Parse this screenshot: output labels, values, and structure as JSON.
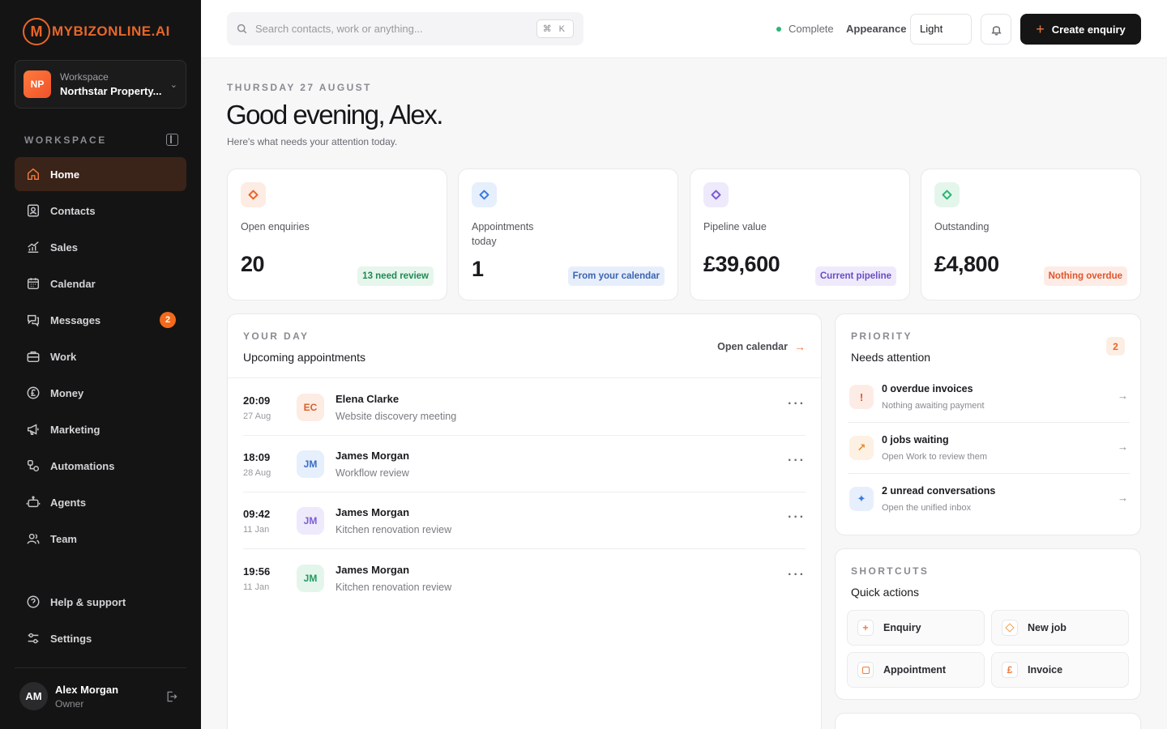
{
  "brand": {
    "logo_mark": "M",
    "logo_text": "MYBIZONLINE.AI",
    "accent": "#e8662a"
  },
  "workspace_switcher": {
    "initials": "NP",
    "label": "Workspace",
    "name": "Northstar Property...",
    "icon": "chevron-down-icon"
  },
  "sidebar": {
    "section_label": "WORKSPACE",
    "items": [
      {
        "label": "Home",
        "icon": "home-icon",
        "active": true
      },
      {
        "label": "Contacts",
        "icon": "contacts-icon"
      },
      {
        "label": "Sales",
        "icon": "sales-chart-icon"
      },
      {
        "label": "Calendar",
        "icon": "calendar-icon"
      },
      {
        "label": "Messages",
        "icon": "messages-icon",
        "badge": "2"
      },
      {
        "label": "Work",
        "icon": "briefcase-icon"
      },
      {
        "label": "Money",
        "icon": "pound-coin-icon"
      },
      {
        "label": "Marketing",
        "icon": "megaphone-icon"
      },
      {
        "label": "Automations",
        "icon": "automation-icon"
      },
      {
        "label": "Agents",
        "icon": "robot-icon"
      },
      {
        "label": "Team",
        "icon": "team-icon"
      }
    ],
    "footer_items": [
      {
        "label": "Help & support",
        "icon": "help-icon"
      },
      {
        "label": "Settings",
        "icon": "settings-icon"
      }
    ],
    "user": {
      "initials": "AM",
      "name": "Alex Morgan",
      "role": "Owner"
    }
  },
  "topbar": {
    "search_placeholder": "Search contacts, work or anything...",
    "shortcut": "⌘ K",
    "status": "Complete",
    "appearance_label": "Appearance",
    "appearance_value": "Light",
    "create_label": "Create enquiry"
  },
  "header": {
    "date": "THURSDAY 27 AUGUST",
    "greeting": "Good evening, Alex.",
    "subtitle": "Here's what needs your attention today."
  },
  "stats": [
    {
      "label": "Open enquiries",
      "value": "20",
      "pill": "13 need review",
      "color": "#e8662a"
    },
    {
      "label": "Appointments today",
      "value": "1",
      "pill": "From your calendar",
      "color": "#3b7be0"
    },
    {
      "label": "Pipeline value",
      "value": "£39,600",
      "pill": "Current pipeline",
      "color": "#7b5cd6"
    },
    {
      "label": "Outstanding",
      "value": "£4,800",
      "pill": "Nothing overdue",
      "color": "#2bb673"
    }
  ],
  "day": {
    "kicker": "YOUR DAY",
    "title": "Upcoming appointments",
    "open_calendar": "Open calendar",
    "appointments": [
      {
        "time": "20:09",
        "date": "27 Aug",
        "initials": "EC",
        "name": "Elena Clarke",
        "subject": "Website discovery meeting"
      },
      {
        "time": "18:09",
        "date": "28 Aug",
        "initials": "JM",
        "name": "James Morgan",
        "subject": "Workflow review"
      },
      {
        "time": "09:42",
        "date": "11 Jan",
        "initials": "JM",
        "name": "James Morgan",
        "subject": "Kitchen renovation review"
      },
      {
        "time": "19:56",
        "date": "11 Jan",
        "initials": "JM",
        "name": "James Morgan",
        "subject": "Kitchen renovation review"
      }
    ]
  },
  "priority": {
    "kicker": "PRIORITY",
    "title": "Needs attention",
    "count": "2",
    "items": [
      {
        "glyph": "!",
        "title": "0 overdue invoices",
        "subtitle": "Nothing awaiting payment"
      },
      {
        "glyph": "↗",
        "title": "0 jobs waiting",
        "subtitle": "Open Work to review them"
      },
      {
        "glyph": "✦",
        "title": "2 unread conversations",
        "subtitle": "Open the unified inbox"
      }
    ]
  },
  "shortcuts": {
    "kicker": "SHORTCUTS",
    "title": "Quick actions",
    "actions": [
      {
        "label": "Enquiry",
        "icon": "plus-icon",
        "glyph": "+"
      },
      {
        "label": "New job",
        "icon": "diamond-icon",
        "glyph": ""
      },
      {
        "label": "Appointment",
        "icon": "square-icon",
        "glyph": ""
      },
      {
        "label": "Invoice",
        "icon": "pound-icon",
        "glyph": "£"
      }
    ]
  }
}
